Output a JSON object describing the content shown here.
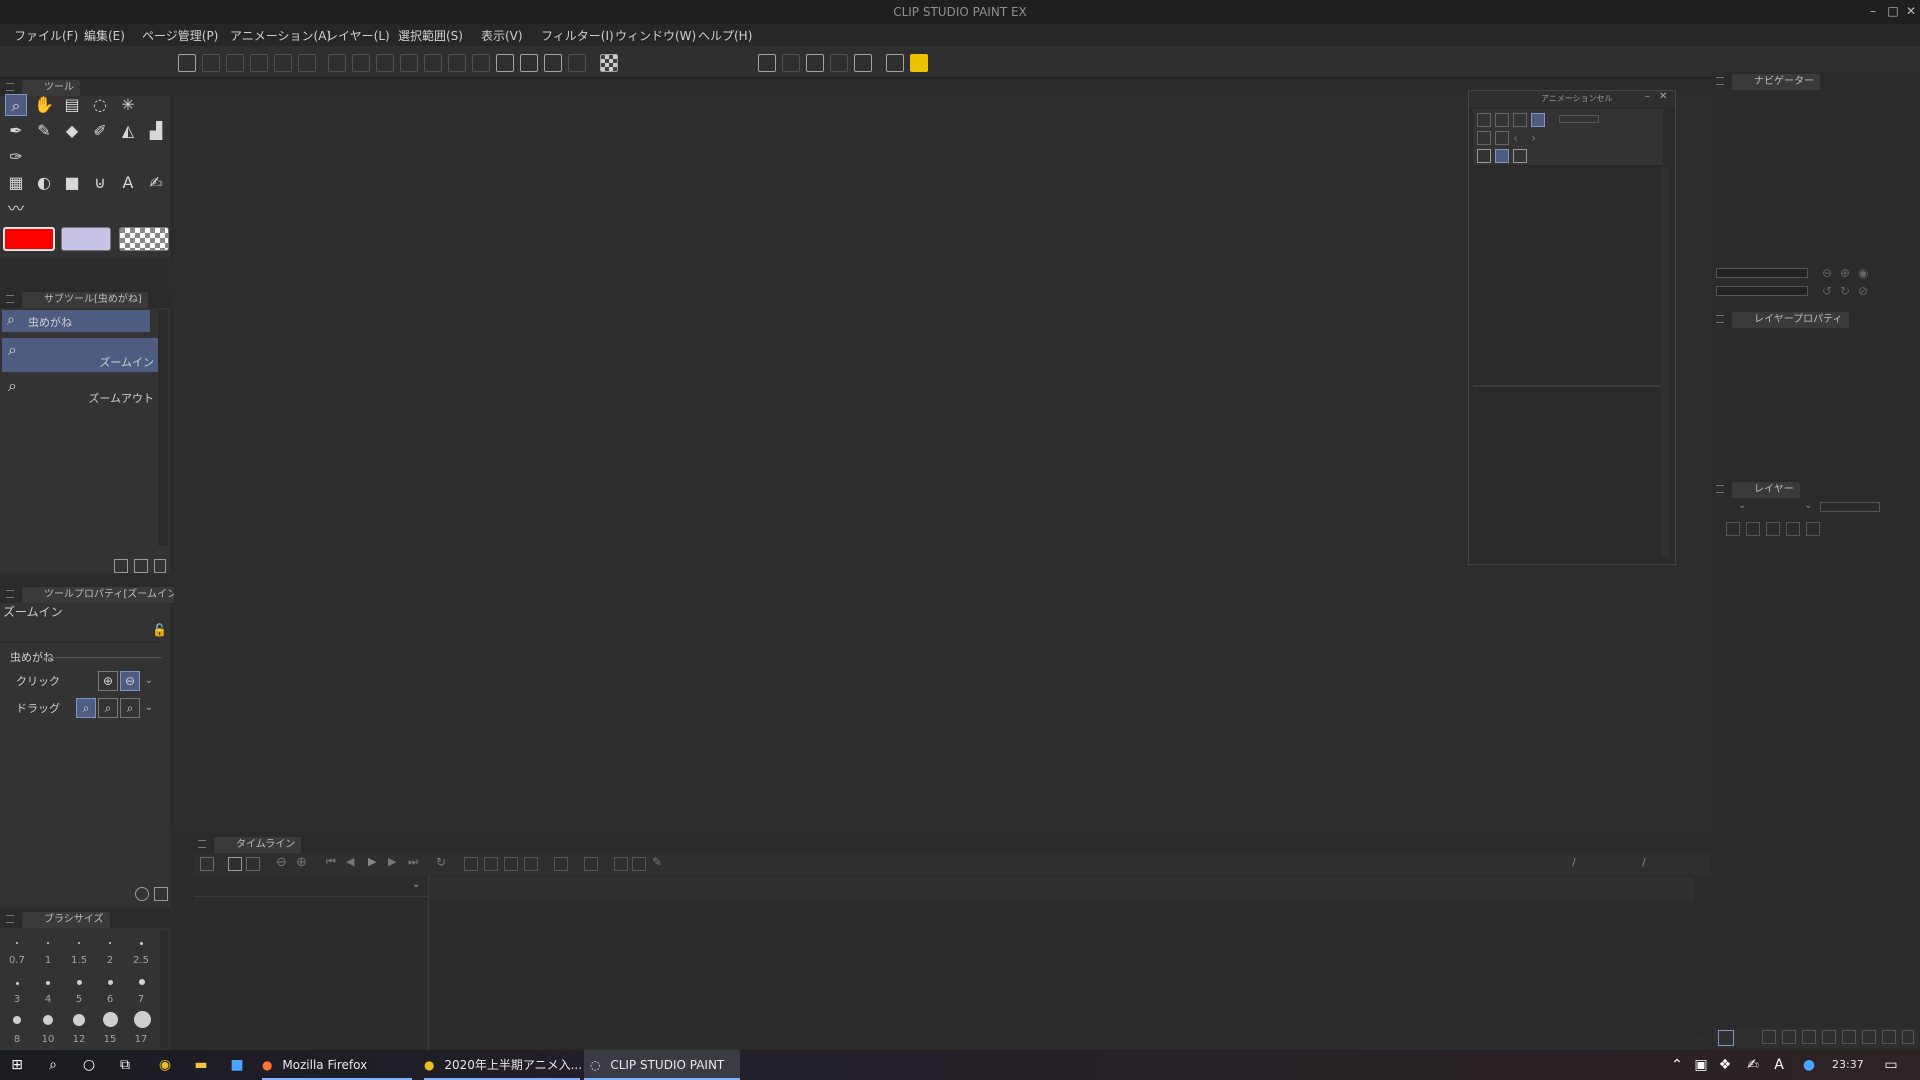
{
  "window": {
    "title": "CLIP STUDIO PAINT EX",
    "minimize": "–",
    "maximize": "□",
    "close": "✕"
  },
  "menu": [
    "ファイル(F)",
    "編集(E)",
    "ページ管理(P)",
    "アニメーション(A)",
    "レイヤー(L)",
    "選択範囲(S)",
    "表示(V)",
    "フィルター(I)",
    "ウィンドウ(W)",
    "ヘルプ(H)"
  ],
  "colors": {
    "main_color": "#ff0000",
    "sub_color": "#c8c4e8",
    "toolbar_swatches": [
      "#000000",
      "#0000ff",
      "#ff0000",
      "#00e000",
      "#ff8000"
    ],
    "accent": "#4d5c80"
  },
  "tool_panel": {
    "tab": "ツール"
  },
  "subtool_panel": {
    "tab": "サブツール[虫めがね]",
    "group": "虫めがね",
    "items": [
      "ズームイン",
      "ズームアウト"
    ]
  },
  "tool_property": {
    "tab": "ツールプロパティ[ズームイン]",
    "name": "ズームイン",
    "section": "虫めがね",
    "click_label": "クリック",
    "drag_label": "ドラッグ"
  },
  "brush_size": {
    "tab": "ブラシサイズ",
    "sizes": [
      "0.7",
      "1",
      "1.5",
      "2",
      "2.5",
      "3",
      "4",
      "5",
      "6",
      "7",
      "8",
      "10",
      "12",
      "15",
      "17"
    ]
  },
  "animation_cel": {
    "title": "アニメーションセル"
  },
  "timeline": {
    "tab": "タイムライン",
    "sep1": "/",
    "sep2": "/"
  },
  "navigator": {
    "tab": "ナビゲーター"
  },
  "layer_property": {
    "tab": "レイヤープロパティ"
  },
  "layer": {
    "tab": "レイヤー"
  },
  "taskbar": {
    "items": [
      "Mozilla Firefox",
      "2020年上半期アニメ入...",
      "CLIP STUDIO PAINT"
    ],
    "clock": "23:37",
    "ime": "A"
  }
}
